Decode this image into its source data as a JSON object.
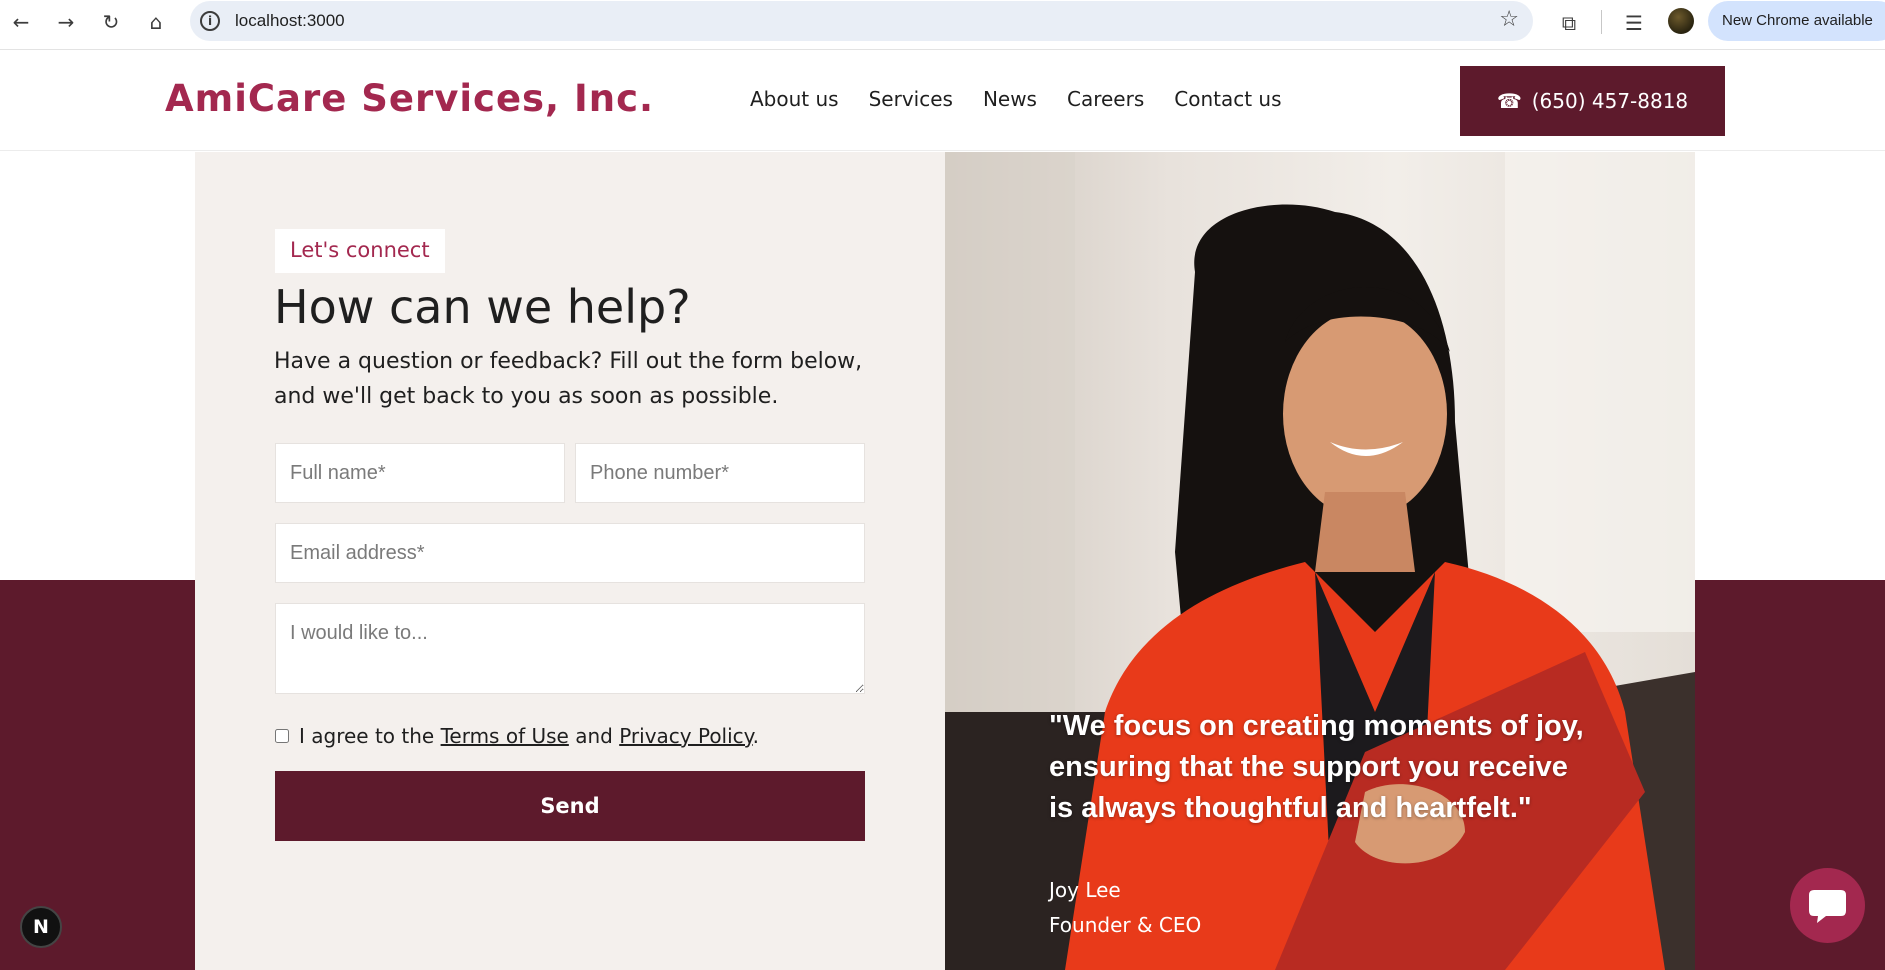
{
  "browser": {
    "url": "localhost:3000",
    "update_label": "New Chrome available",
    "icons": [
      "back-icon",
      "forward-icon",
      "reload-icon",
      "home-icon",
      "info-icon",
      "star-icon",
      "extensions-icon",
      "reading-list-icon",
      "profile-avatar"
    ]
  },
  "header": {
    "brand": "AmiCare Services, Inc.",
    "nav": [
      "About us",
      "Services",
      "News",
      "Careers",
      "Contact us"
    ],
    "phone": "(650) 457-8818",
    "phone_icon": "☎"
  },
  "contact": {
    "tagline": "Let's connect",
    "headline": "How can we help?",
    "subtext_line1": "Have a question or feedback? Fill out the form below,",
    "subtext_line2": "and we'll get back to you as soon as possible.",
    "form": {
      "full_name_placeholder": "Full name*",
      "phone_placeholder": "Phone number*",
      "email_placeholder": "Email address*",
      "message_placeholder": "I would like to...",
      "agree_prefix": "I agree to the",
      "terms_label": "Terms of Use",
      "agree_middle": "and",
      "privacy_label": "Privacy Policy",
      "agree_suffix": ".",
      "send_label": "Send"
    }
  },
  "testimonial": {
    "quote_line1": "\"We focus on creating moments of joy,",
    "quote_line2": "ensuring that the support you receive",
    "quote_line3": "is always thoughtful and heartfelt.\"",
    "name": "Joy Lee",
    "title": "Founder & CEO"
  },
  "badges": {
    "dev_badge": "N"
  },
  "colors": {
    "brand": "#a3284f",
    "maroon": "#5d1a2c",
    "panel": "#f4f0ed",
    "omnibox": "#e9eef6",
    "update_pill": "#d3e3fd"
  }
}
